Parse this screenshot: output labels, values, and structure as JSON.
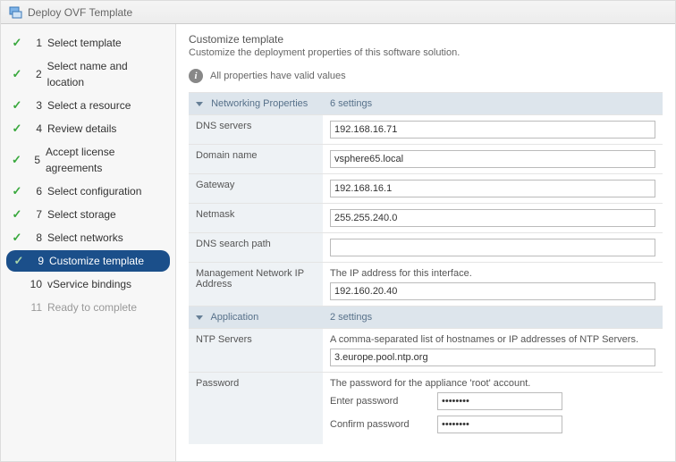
{
  "titlebar": {
    "title": "Deploy OVF Template"
  },
  "sidebar": {
    "steps": [
      {
        "num": "1",
        "label": "Select template",
        "done": true,
        "current": false,
        "enabled": true
      },
      {
        "num": "2",
        "label": "Select name and location",
        "done": true,
        "current": false,
        "enabled": true
      },
      {
        "num": "3",
        "label": "Select a resource",
        "done": true,
        "current": false,
        "enabled": true
      },
      {
        "num": "4",
        "label": "Review details",
        "done": true,
        "current": false,
        "enabled": true
      },
      {
        "num": "5",
        "label": "Accept license agreements",
        "done": true,
        "current": false,
        "enabled": true
      },
      {
        "num": "6",
        "label": "Select configuration",
        "done": true,
        "current": false,
        "enabled": true
      },
      {
        "num": "7",
        "label": "Select storage",
        "done": true,
        "current": false,
        "enabled": true
      },
      {
        "num": "8",
        "label": "Select networks",
        "done": true,
        "current": false,
        "enabled": true
      },
      {
        "num": "9",
        "label": "Customize template",
        "done": true,
        "current": true,
        "enabled": true
      },
      {
        "num": "10",
        "label": "vService bindings",
        "done": false,
        "current": false,
        "enabled": true
      },
      {
        "num": "11",
        "label": "Ready to complete",
        "done": false,
        "current": false,
        "enabled": false
      }
    ]
  },
  "content": {
    "heading": "Customize template",
    "subheading": "Customize the deployment properties of this software solution.",
    "validation_msg": "All properties have valid values",
    "sections": {
      "networking": {
        "title": "Networking Properties",
        "count": "6 settings",
        "fields": {
          "dns_servers": {
            "label": "DNS servers",
            "value": "192.168.16.71"
          },
          "domain_name": {
            "label": "Domain name",
            "value": "vsphere65.local"
          },
          "gateway": {
            "label": "Gateway",
            "value": "192.168.16.1"
          },
          "netmask": {
            "label": "Netmask",
            "value": "255.255.240.0"
          },
          "dns_search": {
            "label": "DNS search path",
            "value": ""
          },
          "mgmt_ip": {
            "label": "Management Network IP Address",
            "desc": "The IP address for this interface.",
            "value": "192.160.20.40"
          }
        }
      },
      "application": {
        "title": "Application",
        "count": "2 settings",
        "fields": {
          "ntp_servers": {
            "label": "NTP Servers",
            "desc": "A comma-separated list of hostnames or IP addresses of NTP Servers.",
            "value": "3.europe.pool.ntp.org"
          },
          "password": {
            "label": "Password",
            "desc": "The password for the appliance 'root' account.",
            "enter_label": "Enter password",
            "confirm_label": "Confirm password",
            "enter_value": "********",
            "confirm_value": "********"
          }
        }
      }
    }
  }
}
